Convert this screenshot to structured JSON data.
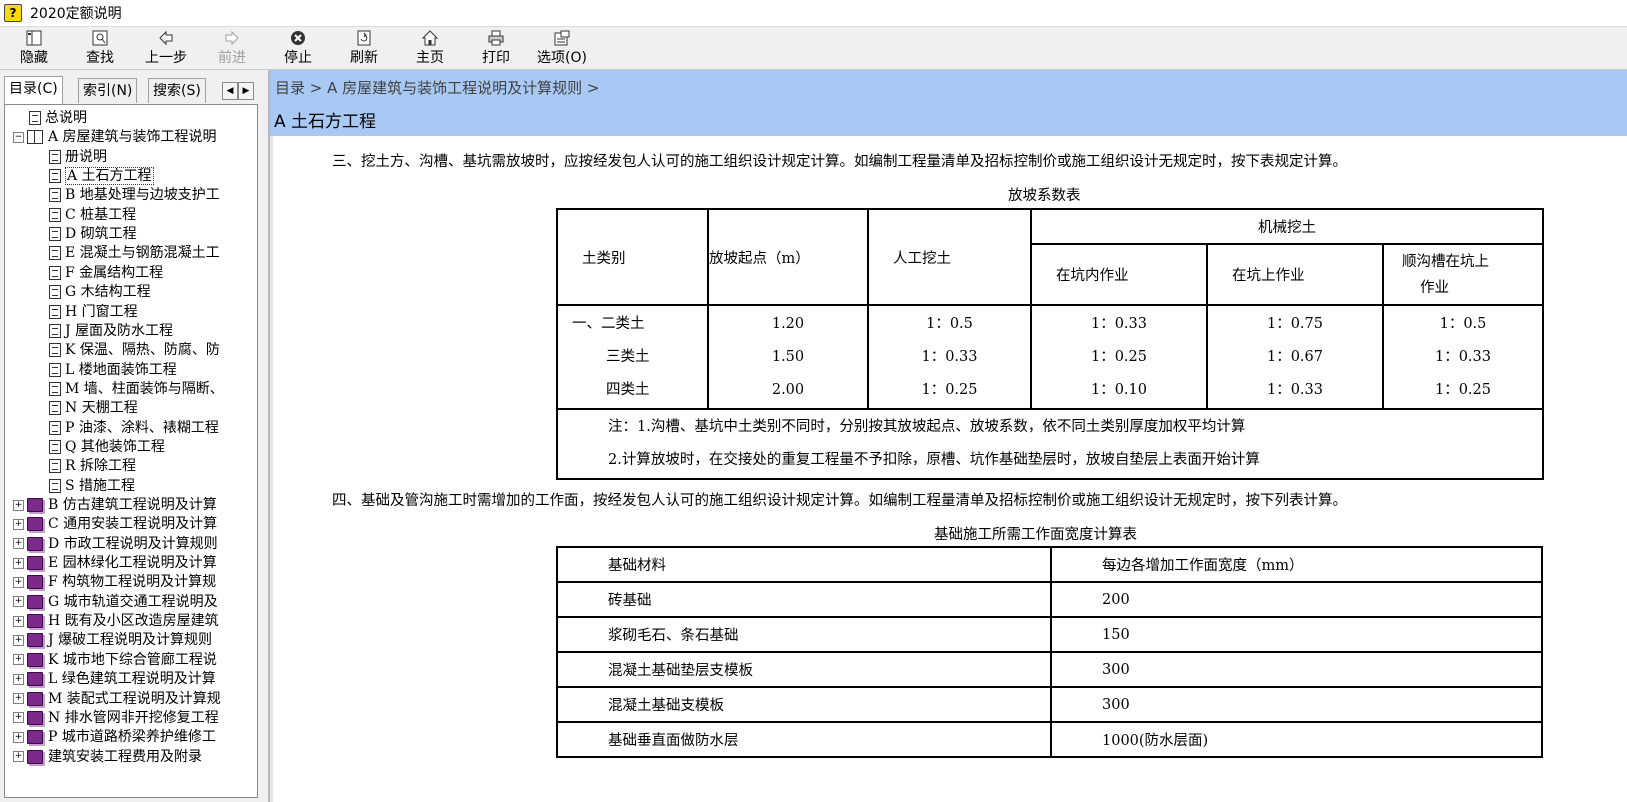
{
  "window": {
    "title": "2020定额说明"
  },
  "toolbar": {
    "hide": "隐藏",
    "find": "查找",
    "back": "上一步",
    "forward": "前进",
    "stop": "停止",
    "refresh": "刷新",
    "home": "主页",
    "print": "打印",
    "options": "选项(O)"
  },
  "tabs": {
    "contents": "目录(C)",
    "index": "索引(N)",
    "search": "搜索(S)"
  },
  "tree": [
    {
      "label": "总说明",
      "level": 1,
      "type": "page"
    },
    {
      "label": "A 房屋建筑与装饰工程说明",
      "level": 0,
      "type": "open-book",
      "expander": "−"
    },
    {
      "label": "册说明",
      "level": 2,
      "type": "page"
    },
    {
      "label": "A 土石方工程",
      "level": 2,
      "type": "page",
      "selected": true
    },
    {
      "label": "B 地基处理与边坡支护工",
      "level": 2,
      "type": "page"
    },
    {
      "label": "C 桩基工程",
      "level": 2,
      "type": "page"
    },
    {
      "label": "D 砌筑工程",
      "level": 2,
      "type": "page"
    },
    {
      "label": "E 混凝土与钢筋混凝土工",
      "level": 2,
      "type": "page"
    },
    {
      "label": "F 金属结构工程",
      "level": 2,
      "type": "page"
    },
    {
      "label": "G 木结构工程",
      "level": 2,
      "type": "page"
    },
    {
      "label": "H 门窗工程",
      "level": 2,
      "type": "page"
    },
    {
      "label": "J 屋面及防水工程",
      "level": 2,
      "type": "page"
    },
    {
      "label": "K 保温、隔热、防腐、防",
      "level": 2,
      "type": "page"
    },
    {
      "label": "L 楼地面装饰工程",
      "level": 2,
      "type": "page"
    },
    {
      "label": "M 墙、柱面装饰与隔断、",
      "level": 2,
      "type": "page"
    },
    {
      "label": "N 天棚工程",
      "level": 2,
      "type": "page"
    },
    {
      "label": "P 油漆、涂料、裱糊工程",
      "level": 2,
      "type": "page"
    },
    {
      "label": "Q 其他装饰工程",
      "level": 2,
      "type": "page"
    },
    {
      "label": "R 拆除工程",
      "level": 2,
      "type": "page"
    },
    {
      "label": "S 措施工程",
      "level": 2,
      "type": "page"
    },
    {
      "label": "B 仿古建筑工程说明及计算",
      "level": 0,
      "type": "book",
      "expander": "+"
    },
    {
      "label": "C 通用安装工程说明及计算",
      "level": 0,
      "type": "book",
      "expander": "+"
    },
    {
      "label": "D 市政工程说明及计算规则",
      "level": 0,
      "type": "book",
      "expander": "+"
    },
    {
      "label": "E 园林绿化工程说明及计算",
      "level": 0,
      "type": "book",
      "expander": "+"
    },
    {
      "label": "F 构筑物工程说明及计算规",
      "level": 0,
      "type": "book",
      "expander": "+"
    },
    {
      "label": "G 城市轨道交通工程说明及",
      "level": 0,
      "type": "book",
      "expander": "+"
    },
    {
      "label": "H 既有及小区改造房屋建筑",
      "level": 0,
      "type": "book",
      "expander": "+"
    },
    {
      "label": "J 爆破工程说明及计算规则",
      "level": 0,
      "type": "book",
      "expander": "+"
    },
    {
      "label": "K 城市地下综合管廊工程说",
      "level": 0,
      "type": "book",
      "expander": "+"
    },
    {
      "label": "L 绿色建筑工程说明及计算",
      "level": 0,
      "type": "book",
      "expander": "+"
    },
    {
      "label": "M 装配式工程说明及计算规",
      "level": 0,
      "type": "book",
      "expander": "+"
    },
    {
      "label": "N 排水管网非开挖修复工程",
      "level": 0,
      "type": "book",
      "expander": "+"
    },
    {
      "label": "P 城市道路桥梁养护维修工",
      "level": 0,
      "type": "book",
      "expander": "+"
    },
    {
      "label": "建筑安装工程费用及附录",
      "level": 0,
      "type": "book",
      "expander": "+"
    }
  ],
  "content": {
    "breadcrumb": "目录 > A 房屋建筑与装饰工程说明及计算规则 >",
    "title": "A 土石方工程",
    "para3": "三、挖土方、沟槽、基坑需放坡时，应按经发包人认可的施工组织设计规定计算。如编制工程量清单及招标控制价或施工组织设计无规定时，按下表规定计算。",
    "slope_caption": "放坡系数表",
    "slope_table": {
      "h_soil": "土类别",
      "h_start": "放坡起点（m）",
      "h_manual": "人工挖土",
      "h_machine": "机械挖土",
      "h_in_pit": "在坑内作业",
      "h_on_pit": "在坑上作业",
      "h_trench1": "顺沟槽在坑上",
      "h_trench2": "作业",
      "soils": [
        "一、二类土",
        "三类土",
        "四类土"
      ],
      "start": [
        "1.20",
        "1.50",
        "2.00"
      ],
      "manual": [
        "1：0.5",
        "1：0.33",
        "1：0.25"
      ],
      "in_pit": [
        "1：0.33",
        "1：0.25",
        "1：0.10"
      ],
      "on_pit": [
        "1：0.75",
        "1：0.67",
        "1：0.33"
      ],
      "trench": [
        "1：0.5",
        "1：0.33",
        "1：0.25"
      ],
      "note1": "注：1.沟槽、基坑中土类别不同时，分别按其放坡起点、放坡系数，依不同土类别厚度加权平均计算",
      "note2": "2.计算放坡时，在交接处的重复工程量不予扣除，原槽、坑作基础垫层时，放坡自垫层上表面开始计算"
    },
    "para4": "四、基础及管沟施工时需增加的工作面，按经发包人认可的施工组织设计规定计算。如编制工程量清单及招标控制价或施工组织设计无规定时，按下列表计算。",
    "found_caption": "基础施工所需工作面宽度计算表",
    "found_table": {
      "h_material": "基础材料",
      "h_width": "每边各增加工作面宽度（mm）",
      "rows": [
        {
          "material": "砖基础",
          "width": "200"
        },
        {
          "material": "浆砌毛石、条石基础",
          "width": "150"
        },
        {
          "material": "混凝土基础垫层支模板",
          "width": "300"
        },
        {
          "material": "混凝土基础支模板",
          "width": "300"
        },
        {
          "material": "基础垂直面做防水层",
          "width": "1000(防水层面)"
        }
      ]
    }
  }
}
